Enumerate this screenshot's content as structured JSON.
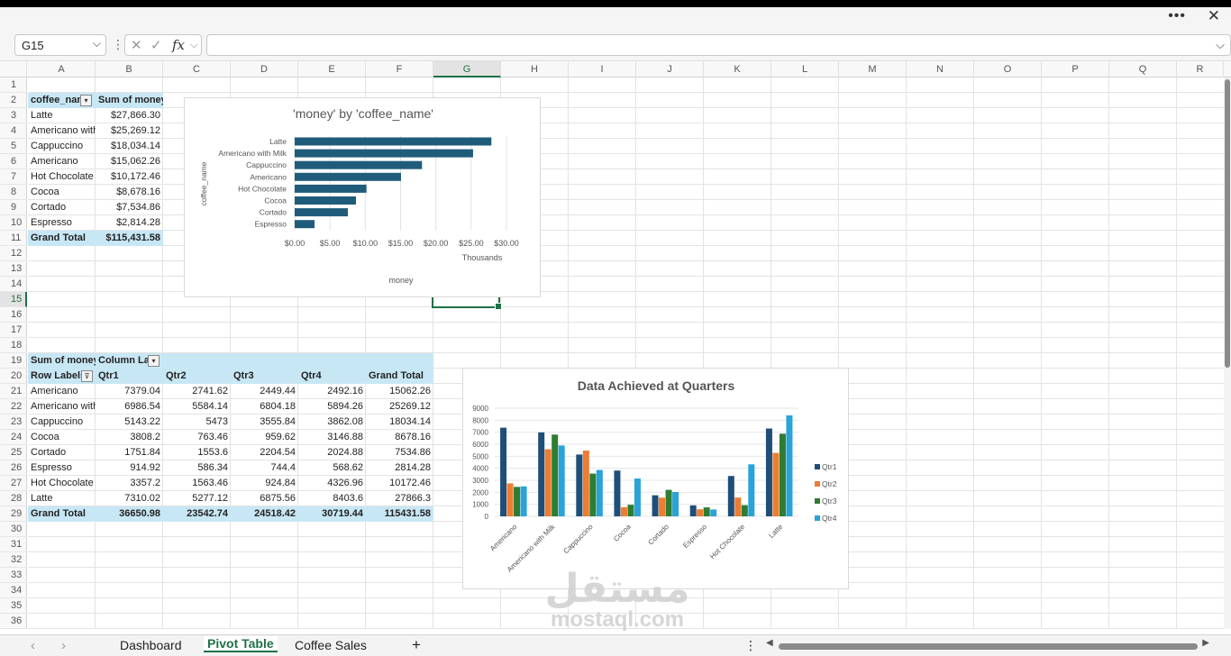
{
  "title_bar": {
    "more_icon": "more-horizontal-icon",
    "close_icon": "close-icon"
  },
  "formula_bar": {
    "name_box": "G15",
    "formula": ""
  },
  "columns": [
    "A",
    "B",
    "C",
    "D",
    "E",
    "F",
    "G",
    "H",
    "I",
    "J",
    "K",
    "L",
    "M",
    "N",
    "O",
    "P",
    "Q",
    "R"
  ],
  "selected_column": "G",
  "rows": [
    "1",
    "2",
    "3",
    "4",
    "5",
    "6",
    "7",
    "8",
    "9",
    "10",
    "11",
    "12",
    "13",
    "14",
    "15",
    "16",
    "17",
    "18",
    "19",
    "20",
    "21",
    "22",
    "23",
    "24",
    "25",
    "26",
    "27",
    "28",
    "29",
    "30",
    "31",
    "32",
    "33",
    "34",
    "35",
    "36"
  ],
  "selected_row": "15",
  "pivot1": {
    "headers": [
      "coffee_nan",
      "Sum of money"
    ],
    "rows": [
      [
        "Latte",
        "$27,866.30"
      ],
      [
        "Americano with",
        "$25,269.12"
      ],
      [
        "Cappuccino",
        "$18,034.14"
      ],
      [
        "Americano",
        "$15,062.26"
      ],
      [
        "Hot Chocolate",
        "$10,172.46"
      ],
      [
        "Cocoa",
        "$8,678.16"
      ],
      [
        "Cortado",
        "$7,534.86"
      ],
      [
        "Espresso",
        "$2,814.28"
      ]
    ],
    "total": [
      "Grand Total",
      "$115,431.58"
    ]
  },
  "pivot2": {
    "row19": [
      "Sum of money",
      "Column Lal"
    ],
    "headers": [
      "Row Labels",
      "Qtr1",
      "Qtr2",
      "Qtr3",
      "Qtr4",
      "Grand Total"
    ],
    "rows": [
      [
        "Americano",
        "7379.04",
        "2741.62",
        "2449.44",
        "2492.16",
        "15062.26"
      ],
      [
        "Americano with",
        "6986.54",
        "5584.14",
        "6804.18",
        "5894.26",
        "25269.12"
      ],
      [
        "Cappuccino",
        "5143.22",
        "5473",
        "3555.84",
        "3862.08",
        "18034.14"
      ],
      [
        "Cocoa",
        "3808.2",
        "763.46",
        "959.62",
        "3146.88",
        "8678.16"
      ],
      [
        "Cortado",
        "1751.84",
        "1553.6",
        "2204.54",
        "2024.88",
        "7534.86"
      ],
      [
        "Espresso",
        "914.92",
        "586.34",
        "744.4",
        "568.62",
        "2814.28"
      ],
      [
        "Hot Chocolate",
        "3357.2",
        "1563.46",
        "924.84",
        "4326.96",
        "10172.46"
      ],
      [
        "Latte",
        "7310.02",
        "5277.12",
        "6875.56",
        "8403.6",
        "27866.3"
      ]
    ],
    "total": [
      "Grand Total",
      "36650.98",
      "23542.74",
      "24518.42",
      "30719.44",
      "115431.58"
    ]
  },
  "chart_data": [
    {
      "type": "bar",
      "orientation": "horizontal",
      "title": "'money' by 'coffee_name'",
      "ylabel": "coffee_name",
      "xlabel": "money",
      "x_unit_label": "Thousands",
      "categories": [
        "Latte",
        "Americano with Milk",
        "Cappuccino",
        "Americano",
        "Hot Chocolate",
        "Cocoa",
        "Cortado",
        "Espresso"
      ],
      "values": [
        27866.3,
        25269.12,
        18034.14,
        15062.26,
        10172.46,
        8678.16,
        7534.86,
        2814.28
      ],
      "xlim": [
        0,
        30000
      ],
      "tick_labels": [
        "$0.00",
        "$5.00",
        "$10.00",
        "$15.00",
        "$20.00",
        "$25.00",
        "$30.00"
      ],
      "color": "#1f5c7a",
      "grid": true
    },
    {
      "type": "bar",
      "title": "Data Achieved at Quarters",
      "categories": [
        "Americano",
        "Americano with Milk",
        "Cappuccino",
        "Cocoa",
        "Cortado",
        "Espresso",
        "Hot Chocolate",
        "Latte"
      ],
      "series": [
        {
          "name": "Qtr1",
          "color": "#1f4e79",
          "values": [
            7379.04,
            6986.54,
            5143.22,
            3808.2,
            1751.84,
            914.92,
            3357.2,
            7310.02
          ]
        },
        {
          "name": "Qtr2",
          "color": "#ed7d31",
          "values": [
            2741.62,
            5584.14,
            5473,
            763.46,
            1553.6,
            586.34,
            1563.46,
            5277.12
          ]
        },
        {
          "name": "Qtr3",
          "color": "#2e7d32",
          "values": [
            2449.44,
            6804.18,
            3555.84,
            959.62,
            2204.54,
            744.4,
            924.84,
            6875.56
          ]
        },
        {
          "name": "Qtr4",
          "color": "#29a3d9",
          "values": [
            2492.16,
            5894.26,
            3862.08,
            3146.88,
            2024.88,
            568.62,
            4326.96,
            8403.6
          ]
        }
      ],
      "ylim": [
        0,
        9000
      ],
      "y_ticks": [
        "0",
        "1000",
        "2000",
        "3000",
        "4000",
        "5000",
        "6000",
        "7000",
        "8000",
        "9000"
      ],
      "legend": "right",
      "grid": true
    }
  ],
  "sheet_tabs": [
    "Dashboard",
    "Pivot Table",
    "Coffee Sales"
  ],
  "active_tab": "Pivot Table",
  "add_sheet": "+",
  "watermark": {
    "arabic": "مستقل",
    "latin": "mostaql.com"
  }
}
